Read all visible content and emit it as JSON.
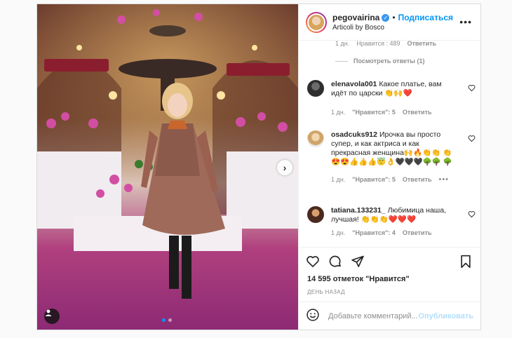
{
  "photo": {
    "title": "Instagram post photo",
    "carousel_total": 2,
    "carousel_index": 1
  },
  "header": {
    "username": "pegovairina",
    "separator": "•",
    "follow_label": "Подписаться",
    "location": "Articoli by Bosco"
  },
  "top_meta": {
    "time": "1 дн.",
    "likes": "Нравится : 489",
    "reply": "Ответить"
  },
  "view_replies_label": "Посмотреть ответы (1)",
  "comments": [
    {
      "username": "elenavola001",
      "text": "Какое платье, вам идёт по царски 👏🙌❤️",
      "time": "1 дн.",
      "likes": "\"Нравится\": 5",
      "reply": "Ответить"
    },
    {
      "username": "osadcuks912",
      "text": "Ирочка вы просто супер, и как актриса и как прекрасная женщина🙌🔥👏👏 👏😍😍👍👍👍😇👌🖤🖤🖤🌳🌳 🌳",
      "time": "1 дн.",
      "likes": "\"Нравится\": 5",
      "reply": "Ответить",
      "more": "•••"
    },
    {
      "username": "tatiana.133231_",
      "text": "Любимица наша, лучшая! 👏👏👏❤️❤️❤️",
      "time": "1 дн.",
      "likes": "\"Нравится\": 4",
      "reply": "Ответить"
    }
  ],
  "likes_count": "14 595 отметок \"Нравится\"",
  "posted_ago": "ДЕНЬ НАЗАД",
  "add_comment": {
    "placeholder": "Добавьте комментарий...",
    "publish_label": "Опубликовать"
  },
  "colors": {
    "accent": "#0095f6",
    "heart_red": "#ed4956",
    "muted": "#8e8e8e"
  }
}
